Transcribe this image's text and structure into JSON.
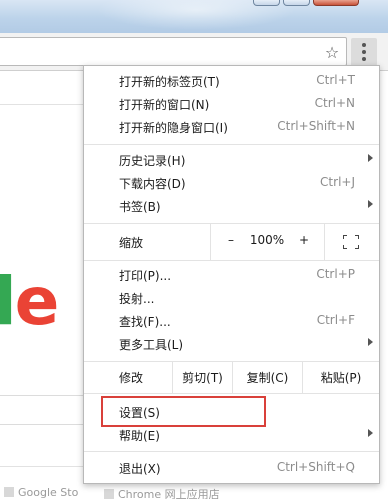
{
  "menu": {
    "items_group1": [
      {
        "label": "打开新的标签页(T)",
        "accel": "Ctrl+T"
      },
      {
        "label": "打开新的窗口(N)",
        "accel": "Ctrl+N"
      },
      {
        "label": "打开新的隐身窗口(I)",
        "accel": "Ctrl+Shift+N"
      }
    ],
    "items_group2": [
      {
        "label": "历史记录(H)"
      },
      {
        "label": "下载内容(D)",
        "accel": "Ctrl+J"
      },
      {
        "label": "书签(B)"
      }
    ],
    "zoom": {
      "label": "缩放",
      "minus": "–",
      "value": "100%",
      "plus": "+"
    },
    "items_group3": [
      {
        "label": "打印(P)...",
        "accel": "Ctrl+P"
      },
      {
        "label": "投射..."
      },
      {
        "label": "查找(F)...",
        "accel": "Ctrl+F"
      },
      {
        "label": "更多工具(L)"
      }
    ],
    "edit": {
      "label": "修改",
      "cut": "剪切(T)",
      "copy": "复制(C)",
      "paste": "粘贴(P)"
    },
    "items_group4": [
      {
        "label": "设置(S)"
      },
      {
        "label": "帮助(E)"
      }
    ],
    "exit": {
      "label": "退出(X)",
      "accel": "Ctrl+Shift+Q"
    }
  },
  "page": {
    "logo_fragment_l": "l",
    "logo_fragment_e": "e",
    "shortcut_1": "Google Sto",
    "shortcut_2": "Chrome 网上应用店"
  },
  "colors": {
    "highlight": "#d9403a",
    "logo_green": "#34a853",
    "logo_red": "#ea4335"
  },
  "icons": [
    "star-icon",
    "menu-dots-icon",
    "fullscreen-icon",
    "chevron-right-icon"
  ]
}
